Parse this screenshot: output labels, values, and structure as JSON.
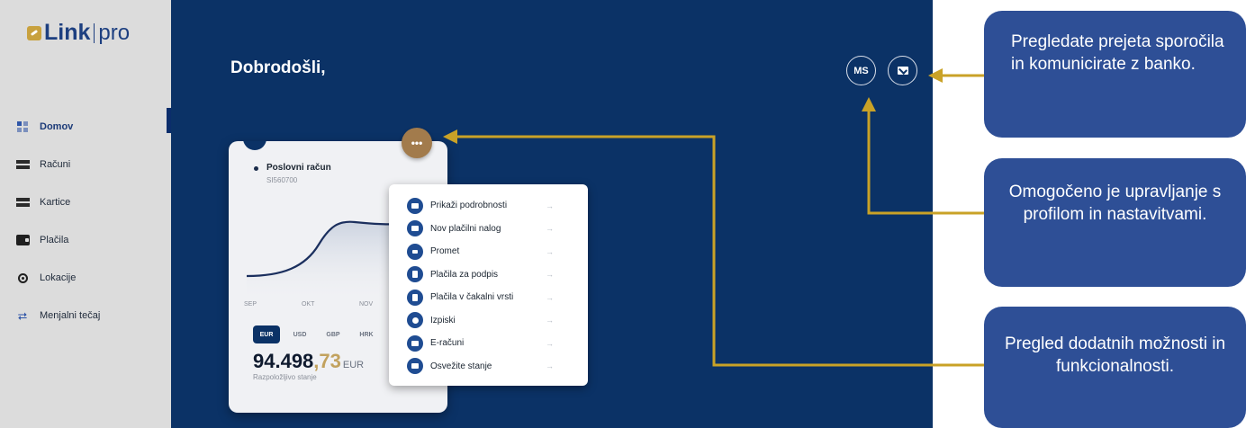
{
  "logo": {
    "name": "Link",
    "suffix": "pro"
  },
  "sidebar": {
    "items": [
      {
        "label": "Domov",
        "icon": "home-grid-icon",
        "active": true
      },
      {
        "label": "Računi",
        "icon": "accounts-card-icon"
      },
      {
        "label": "Kartice",
        "icon": "credit-card-icon"
      },
      {
        "label": "Plačila",
        "icon": "wallet-icon"
      },
      {
        "label": "Lokacije",
        "icon": "location-pin-icon"
      },
      {
        "label": "Menjalni tečaj",
        "icon": "exchange-icon"
      }
    ]
  },
  "header": {
    "welcome": "Dobrodošli,",
    "profile_initials": "MS",
    "messages_icon": "envelope-icon"
  },
  "account": {
    "name": "Poslovni račun",
    "iban": "SI560700",
    "months": [
      "SEP",
      "OKT",
      "NOV"
    ],
    "currencies": [
      "EUR",
      "USD",
      "GBP",
      "HRK"
    ],
    "selected_currency": "EUR",
    "balance_whole": "94.498",
    "balance_decimals": ",73",
    "balance_currency": "EUR",
    "balance_label": "Razpoložljivo stanje",
    "more_button": "•••"
  },
  "menu": {
    "items": [
      {
        "label": "Prikaži podrobnosti",
        "icon": "details-icon"
      },
      {
        "label": "Nov plačilni nalog",
        "icon": "new-payment-icon"
      },
      {
        "label": "Promet",
        "icon": "bar-chart-icon"
      },
      {
        "label": "Plačila za podpis",
        "icon": "document-sign-icon"
      },
      {
        "label": "Plačila v čakalni vrsti",
        "icon": "document-queue-icon"
      },
      {
        "label": "Izpiski",
        "icon": "statement-icon"
      },
      {
        "label": "E-računi",
        "icon": "e-invoice-icon"
      },
      {
        "label": "Osvežite stanje",
        "icon": "refresh-balance-icon"
      }
    ],
    "arrow": "→"
  },
  "callouts": {
    "messages": "Pregledate prejeta sporočila in komunicirate z banko.",
    "profile": "Omogočeno je upravljanje s profilom in nastavitvami.",
    "options": "Pregled dodatnih možnosti in funkcionalnosti."
  },
  "colors": {
    "main_bg": "#0b3266",
    "sidebar_bg": "#dcdcdc",
    "accent_gold": "#c9a227",
    "callout_bg": "#2e4f96",
    "more_button": "#a27b4c"
  }
}
